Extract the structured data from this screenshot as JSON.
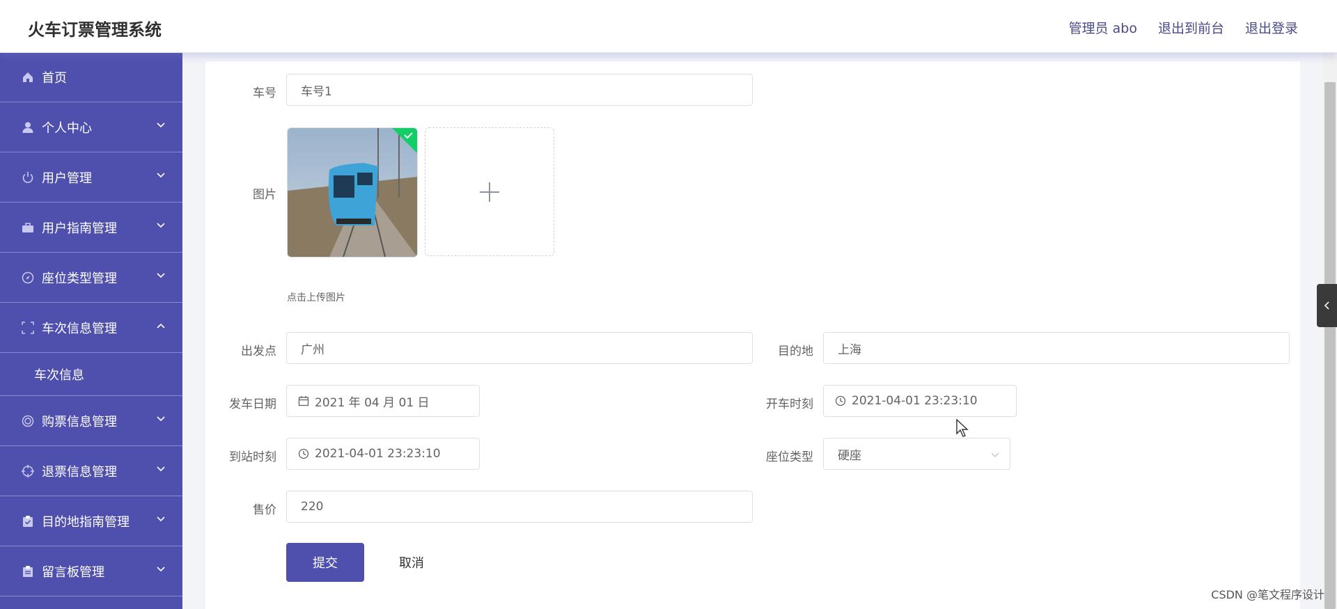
{
  "header": {
    "app_title": "火车订票管理系统",
    "admin_label": "管理员 abo",
    "back_to_front": "退出到前台",
    "logout": "退出登录"
  },
  "sidebar": {
    "items": [
      {
        "label": "首页",
        "icon": "home-icon"
      },
      {
        "label": "个人中心",
        "icon": "user-icon"
      },
      {
        "label": "用户管理",
        "icon": "power-icon"
      },
      {
        "label": "用户指南管理",
        "icon": "briefcase-icon"
      },
      {
        "label": "座位类型管理",
        "icon": "compass-icon"
      },
      {
        "label": "车次信息管理",
        "icon": "frame-icon"
      },
      {
        "label": "购票信息管理",
        "icon": "ring-icon"
      },
      {
        "label": "退票信息管理",
        "icon": "target-icon"
      },
      {
        "label": "目的地指南管理",
        "icon": "clipboard-icon"
      },
      {
        "label": "留言板管理",
        "icon": "notepad-icon"
      }
    ],
    "submenu": {
      "label": "车次信息"
    }
  },
  "form": {
    "train_no": {
      "label": "车号",
      "value": "车号1"
    },
    "image": {
      "label": "图片",
      "hint": "点击上传图片"
    },
    "departure": {
      "label": "出发点",
      "value": "广州"
    },
    "destination": {
      "label": "目的地",
      "value": "上海"
    },
    "depart_date": {
      "label": "发车日期",
      "value": "2021 年 04 月 01 日"
    },
    "start_time": {
      "label": "开车时刻",
      "value": "2021-04-01 23:23:10"
    },
    "arrive_time": {
      "label": "到站时刻",
      "value": "2021-04-01 23:23:10"
    },
    "seat_type": {
      "label": "座位类型",
      "value": "硬座"
    },
    "price": {
      "label": "售价",
      "value": "220"
    },
    "submit": "提交",
    "cancel": "取消"
  },
  "watermark": "CSDN @笔文程序设计",
  "colors": {
    "primary": "#4f4fae",
    "header_text": "#4a4a8a"
  }
}
